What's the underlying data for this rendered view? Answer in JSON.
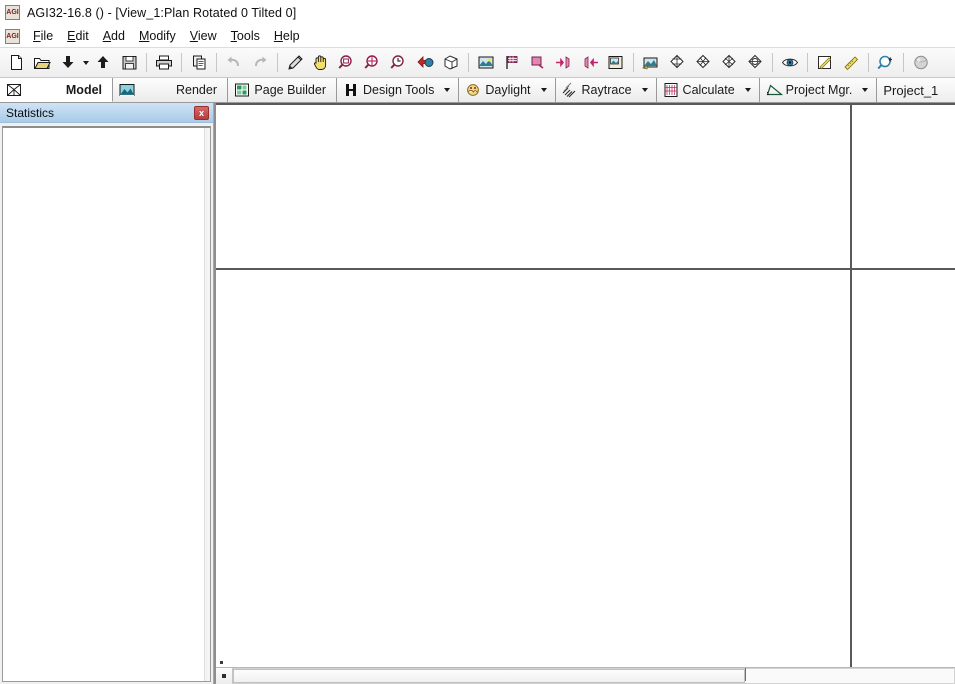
{
  "window": {
    "app_icon": "agi32-app-icon",
    "title": "AGI32-16.8 () - [View_1:Plan Rotated 0 Tilted 0]"
  },
  "menubar": {
    "icon": "agi32-app-icon",
    "items": [
      {
        "label": "File",
        "accel": "F"
      },
      {
        "label": "Edit",
        "accel": "E"
      },
      {
        "label": "Add",
        "accel": "A"
      },
      {
        "label": "Modify",
        "accel": "M"
      },
      {
        "label": "View",
        "accel": "V"
      },
      {
        "label": "Tools",
        "accel": "T"
      },
      {
        "label": "Help",
        "accel": "H"
      }
    ]
  },
  "toolbar": {
    "groups": [
      {
        "buttons": [
          {
            "icon": "new-file-icon",
            "tooltip": "New"
          },
          {
            "icon": "open-folder-icon",
            "tooltip": "Open"
          },
          {
            "icon": "import-down-arrow-icon",
            "tooltip": "Import",
            "has_dropdown": true
          },
          {
            "icon": "export-up-arrow-icon",
            "tooltip": "Export"
          },
          {
            "icon": "save-floppy-icon",
            "tooltip": "Save"
          }
        ]
      },
      {
        "buttons": [
          {
            "icon": "print-icon",
            "tooltip": "Print"
          }
        ]
      },
      {
        "buttons": [
          {
            "icon": "copy-icon",
            "tooltip": "Copy"
          }
        ]
      },
      {
        "buttons": [
          {
            "icon": "undo-icon",
            "tooltip": "Undo"
          },
          {
            "icon": "redo-icon",
            "tooltip": "Redo"
          }
        ]
      },
      {
        "buttons": [
          {
            "icon": "pencil-icon",
            "tooltip": "Draw"
          },
          {
            "icon": "pan-hand-icon",
            "tooltip": "Pan"
          },
          {
            "icon": "zoom-window-icon",
            "tooltip": "Zoom Window"
          },
          {
            "icon": "zoom-extents-icon",
            "tooltip": "Zoom Extents"
          },
          {
            "icon": "zoom-previous-icon",
            "tooltip": "Zoom Previous"
          },
          {
            "icon": "zoom-in-out-icon",
            "tooltip": "Zoom In/Out"
          },
          {
            "icon": "cube-wireframe-icon",
            "tooltip": "3D View"
          }
        ]
      },
      {
        "buttons": [
          {
            "icon": "render-scene-icon",
            "tooltip": "Render"
          },
          {
            "icon": "flag-dark-icon",
            "tooltip": "Mark"
          },
          {
            "icon": "flag-light-icon",
            "tooltip": "Mark Light"
          },
          {
            "icon": "arrow-right-pin-icon",
            "tooltip": "Insert Right"
          },
          {
            "icon": "arrow-left-pin-icon",
            "tooltip": "Insert Left"
          },
          {
            "icon": "image-edit-icon",
            "tooltip": "Image"
          }
        ]
      },
      {
        "buttons": [
          {
            "icon": "photo-tool-icon",
            "tooltip": "Photo Tool"
          },
          {
            "icon": "octahedron-1-icon",
            "tooltip": "View 1"
          },
          {
            "icon": "octahedron-2-icon",
            "tooltip": "View 2"
          },
          {
            "icon": "octahedron-3-icon",
            "tooltip": "View 3"
          },
          {
            "icon": "octahedron-4-icon",
            "tooltip": "View 4"
          }
        ]
      },
      {
        "buttons": [
          {
            "icon": "eye-preview-icon",
            "tooltip": "Preview"
          }
        ]
      },
      {
        "buttons": [
          {
            "icon": "measure-area-icon",
            "tooltip": "Measure Area"
          },
          {
            "icon": "measure-ruler-icon",
            "tooltip": "Measure Distance"
          }
        ]
      },
      {
        "buttons": [
          {
            "icon": "zoom-back-icon",
            "tooltip": "Zoom Back"
          }
        ]
      },
      {
        "buttons": [
          {
            "icon": "sphere-gray-icon",
            "tooltip": "Material"
          }
        ]
      }
    ]
  },
  "ribbon": {
    "tabs": [
      {
        "label": "Model",
        "icon": "model-cube-icon",
        "active": true,
        "bold": true,
        "dropdown": false
      },
      {
        "label": "Render",
        "icon": "render-scene-icon",
        "active": false,
        "bold": false,
        "dropdown": false
      },
      {
        "label": "Page Builder",
        "icon": "page-builder-icon",
        "active": false,
        "bold": false,
        "dropdown": false
      },
      {
        "label": "Design Tools",
        "icon": "design-tools-icon",
        "active": false,
        "bold": false,
        "dropdown": true
      },
      {
        "label": "Daylight",
        "icon": "daylight-sun-icon",
        "active": false,
        "bold": false,
        "dropdown": true
      },
      {
        "label": "Raytrace",
        "icon": "raytrace-icon",
        "active": false,
        "bold": false,
        "dropdown": true
      },
      {
        "label": "Calculate",
        "icon": "calculate-grid-icon",
        "active": false,
        "bold": false,
        "dropdown": true
      },
      {
        "label": "Project Mgr.",
        "icon": "project-mgr-icon",
        "active": false,
        "bold": false,
        "dropdown": true
      }
    ],
    "project_name": "Project_1"
  },
  "sidebar": {
    "panel_title": "Statistics",
    "close_label": "x",
    "content": ""
  },
  "viewport": {
    "name": "View_1",
    "scrollbar": {
      "thumb_percent": 71
    }
  },
  "colors": {
    "accent_panel_header": "#a8cbe8",
    "close_button": "#b83c3c",
    "viewport_line": "#595959",
    "toolbar_bg": "#f0f0f0",
    "ribbon_border": "#9a9a9a"
  }
}
